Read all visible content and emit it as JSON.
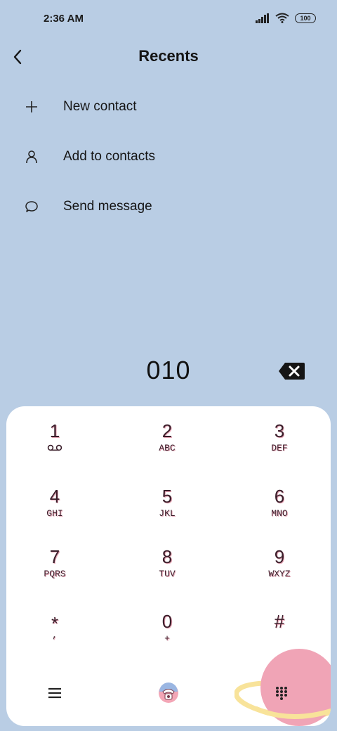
{
  "status_bar": {
    "time": "2:36 AM",
    "battery": "100"
  },
  "header": {
    "title": "Recents"
  },
  "menu": {
    "items": [
      {
        "label": "New contact",
        "icon": "plus-icon"
      },
      {
        "label": "Add to contacts",
        "icon": "person-icon"
      },
      {
        "label": "Send message",
        "icon": "message-bubble-icon"
      }
    ]
  },
  "dialer": {
    "number": "010",
    "keys": [
      {
        "digit": "1",
        "letters": "voicemail-icon"
      },
      {
        "digit": "2",
        "letters": "ABC"
      },
      {
        "digit": "3",
        "letters": "DEF"
      },
      {
        "digit": "4",
        "letters": "GHI"
      },
      {
        "digit": "5",
        "letters": "JKL"
      },
      {
        "digit": "6",
        "letters": "MNO"
      },
      {
        "digit": "7",
        "letters": "PQRS"
      },
      {
        "digit": "8",
        "letters": "TUV"
      },
      {
        "digit": "9",
        "letters": "WXYZ"
      },
      {
        "digit": "*",
        "letters": ","
      },
      {
        "digit": "0",
        "letters": "+"
      },
      {
        "digit": "#",
        "letters": ""
      }
    ]
  },
  "colors": {
    "background": "#b9cde4",
    "keypad": "#ffffff",
    "key_text": "#3a1e2a",
    "key_shadow": "#e7a6b6",
    "call_button": "#f3a6b6"
  }
}
